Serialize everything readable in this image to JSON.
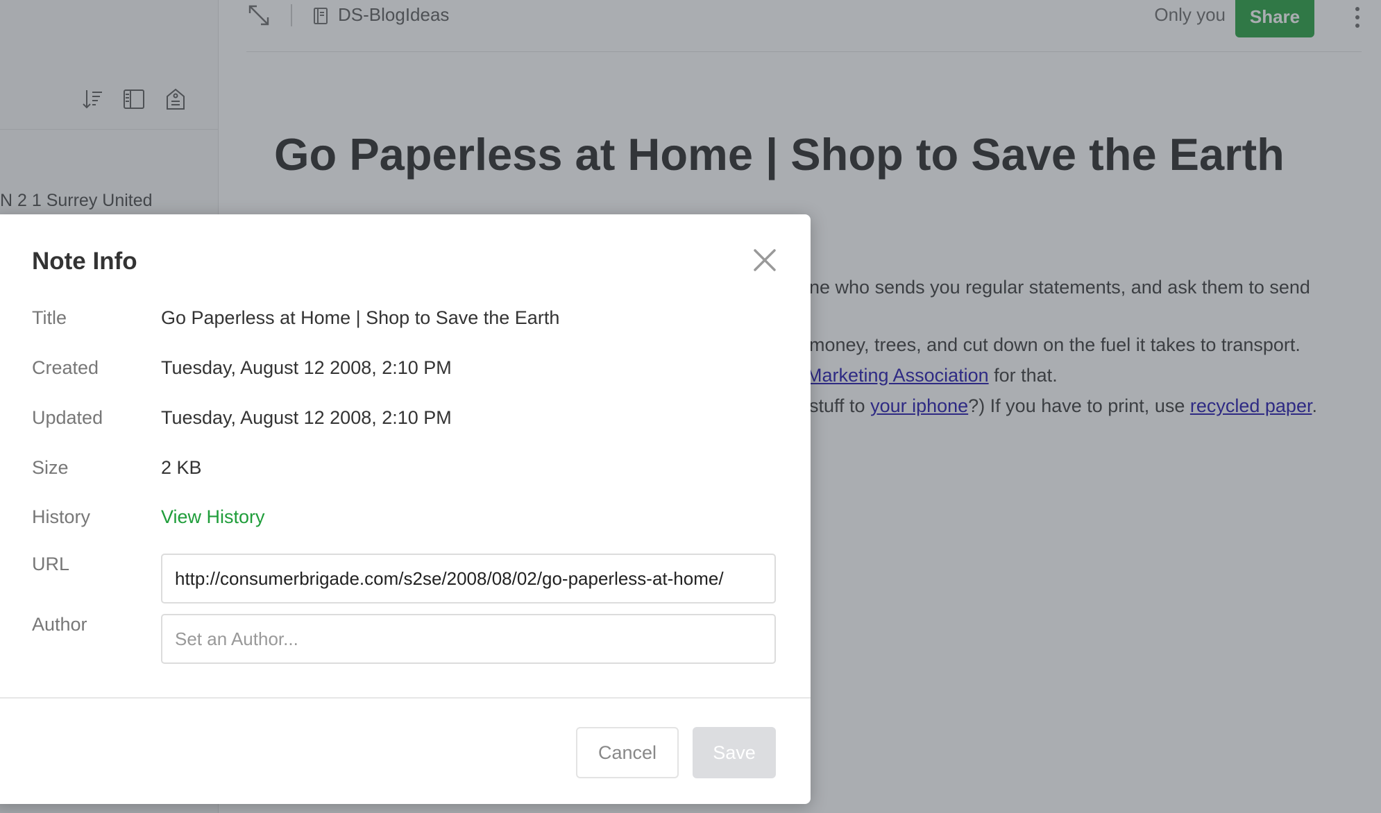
{
  "sidebar": {
    "snippet": "N 2 1 Surrey United",
    "tools": [
      "sort-icon",
      "view-options-icon",
      "tag-icon"
    ]
  },
  "topbar": {
    "notebook_name": "DS-BlogIdeas",
    "visibility": "Only you",
    "share_label": "Share"
  },
  "note": {
    "title": "Go Paperless at Home | Shop to Save the Earth",
    "lines": [
      {
        "pre": "ne who sends you regular statements, and ask them to send"
      },
      {
        "pre": "money, trees, and cut down on the fuel it takes to transport."
      },
      {
        "link1": "Marketing Association",
        "post": " for that."
      },
      {
        "pre": " stuff to ",
        "link1": "your iphone",
        "mid": "?) If you have to print, use ",
        "link2": "recycled paper",
        "post": "."
      }
    ]
  },
  "modal": {
    "title": "Note Info",
    "fields": {
      "title_label": "Title",
      "title_value": "Go Paperless at Home | Shop to Save the Earth",
      "created_label": "Created",
      "created_value": "Tuesday, August 12 2008, 2:10 PM",
      "updated_label": "Updated",
      "updated_value": "Tuesday, August 12 2008, 2:10 PM",
      "size_label": "Size",
      "size_value": "2 KB",
      "history_label": "History",
      "history_link": "View History",
      "url_label": "URL",
      "url_value": "http://consumerbrigade.com/s2se/2008/08/02/go-paperless-at-home/",
      "author_label": "Author",
      "author_placeholder": "Set an Author..."
    },
    "cancel_label": "Cancel",
    "save_label": "Save"
  },
  "colors": {
    "accent_green": "#1f9d3a",
    "link_blue": "#1a0dab",
    "overlay": "#464c54"
  }
}
